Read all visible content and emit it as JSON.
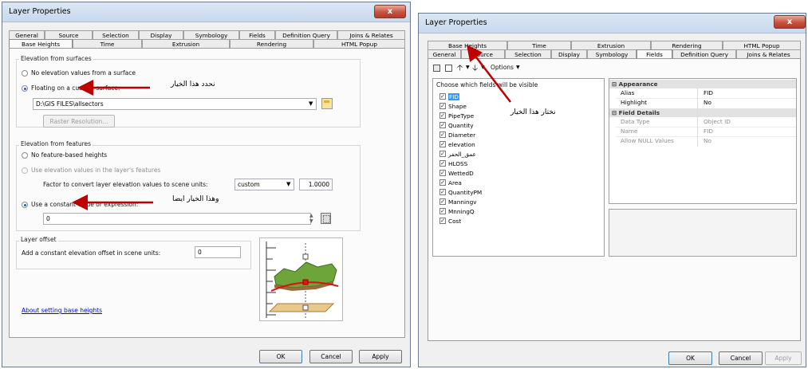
{
  "left_dialog": {
    "title": "Layer Properties",
    "close_label": "x",
    "tabs_row1": [
      "General",
      "Source",
      "Selection",
      "Display",
      "Symbology",
      "Fields",
      "Definition Query",
      "Joins & Relates"
    ],
    "tabs_row2": [
      "Base Heights",
      "Time",
      "Extrusion",
      "Rendering",
      "HTML Popup"
    ],
    "active_tab": "Base Heights",
    "elevation_surfaces": {
      "group_label": "Elevation from surfaces",
      "option_none": "No elevation values from a surface",
      "option_floating": "Floating on a custom surface:",
      "surface_path": "D:\\GIS FILES\\allsectors",
      "raster_button": "Raster Resolution..."
    },
    "elevation_features": {
      "group_label": "Elevation from features",
      "option_none": "No feature-based heights",
      "option_use_values": "Use elevation values in the layer's features",
      "factor_label": "Factor to convert layer elevation values to scene units:",
      "factor_unit": "custom",
      "factor_value": "1.0000",
      "option_constant": "Use a constant value or expression:",
      "constant_value": "0"
    },
    "layer_offset": {
      "group_label": "Layer offset",
      "label": "Add a constant elevation offset in scene units:",
      "value": "0"
    },
    "help_link": "About setting base heights",
    "buttons": {
      "ok": "OK",
      "cancel": "Cancel",
      "apply": "Apply"
    },
    "annotations": {
      "surface_note": "نحدد هذا الخيار",
      "constant_note": "وهذا الخيار ايضا"
    }
  },
  "right_dialog": {
    "title": "Layer Properties",
    "close_label": "x",
    "tabs_row1": [
      "Base Heights",
      "Time",
      "Extrusion",
      "Rendering",
      "HTML Popup"
    ],
    "tabs_row2": [
      "General",
      "Source",
      "Selection",
      "Display",
      "Symbology",
      "Fields",
      "Definition Query",
      "Joins & Relates"
    ],
    "active_tab": "Fields",
    "toolbar": {
      "options_label": "Options"
    },
    "fields_list": {
      "header": "Choose which fields will be visible",
      "fields": [
        "FID",
        "Shape",
        "PipeType",
        "Quantity",
        "Diameter",
        "elevation",
        "عمق_الحفر",
        "HLOSS",
        "WettedD",
        "Area",
        "QuantityPM",
        "Manningv",
        "MnningQ",
        "Cost"
      ]
    },
    "properties": {
      "appearance_header": "Appearance",
      "appearance_rows": [
        {
          "key": "Alias",
          "value": "FID"
        },
        {
          "key": "Highlight",
          "value": "No"
        }
      ],
      "details_header": "Field Details",
      "details_rows": [
        {
          "key": "Data Type",
          "value": "Object ID"
        },
        {
          "key": "Name",
          "value": "FID"
        },
        {
          "key": "Allow NULL Values",
          "value": "No"
        }
      ]
    },
    "buttons": {
      "ok": "OK",
      "cancel": "Cancel",
      "apply": "Apply"
    },
    "annotations": {
      "tab_note": "نختار هذا الخيار"
    }
  }
}
